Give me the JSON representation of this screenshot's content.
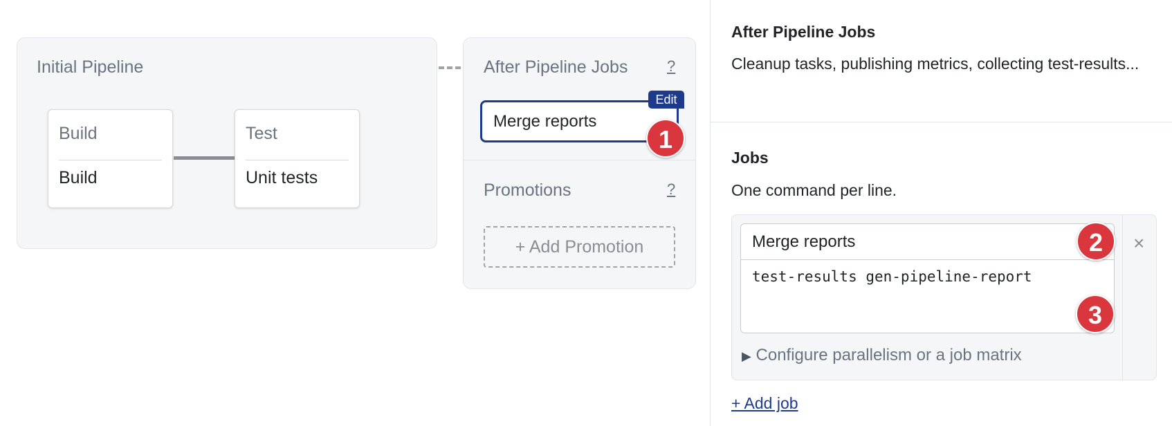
{
  "canvas": {
    "initial_pipeline": {
      "title": "Initial Pipeline",
      "blocks": [
        {
          "name": "Build",
          "job": "Build"
        },
        {
          "name": "Test",
          "job": "Unit tests"
        }
      ]
    },
    "after_pipeline": {
      "title": "After Pipeline Jobs",
      "help": "?",
      "job": "Merge reports",
      "edit_label": "Edit"
    },
    "promotions": {
      "title": "Promotions",
      "help": "?",
      "add_label": "+ Add Promotion"
    }
  },
  "annotations": [
    "1",
    "2",
    "3"
  ],
  "sidebar": {
    "title": "After Pipeline Jobs",
    "description": "Cleanup tasks, publishing metrics, collecting test-results...",
    "jobs_heading": "Jobs",
    "jobs_hint": "One command per line.",
    "job": {
      "name": "Merge reports",
      "commands": "test-results gen-pipeline-report",
      "configure_label": "Configure parallelism or a job matrix",
      "remove_icon": "close-icon"
    },
    "add_job_label": "+ Add job"
  },
  "colors": {
    "accent": "#1e3a8a",
    "badge": "#d9363e"
  }
}
